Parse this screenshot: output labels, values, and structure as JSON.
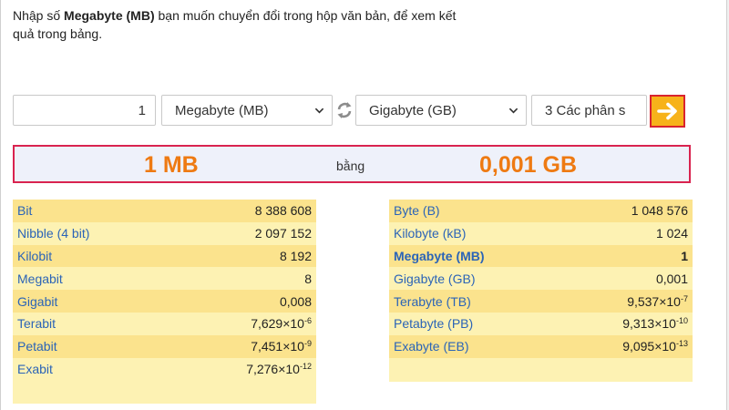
{
  "intro": {
    "prefix": "Nhập số ",
    "unit_bold": "Megabyte (MB)",
    "suffix": " bạn muốn chuyển đổi trong hộp văn bản, để xem kết quả trong bảng."
  },
  "form": {
    "input_value": "1",
    "from_unit": "Megabyte (MB)",
    "to_unit": "Gigabyte (GB)",
    "decimals": "3 Các phân s",
    "icons": {
      "swap": "swap-icon",
      "go": "arrow-right-icon",
      "caret": "chevron-down-icon"
    }
  },
  "result": {
    "from": "1 MB",
    "equals": "bằng",
    "to": "0,001 GB"
  },
  "bit_table": [
    {
      "label": "Bit",
      "value": "8 388 608"
    },
    {
      "label": "Nibble (4 bit)",
      "value": "2 097 152"
    },
    {
      "label": "Kilobit",
      "value": "8 192"
    },
    {
      "label": "Megabit",
      "value": "8"
    },
    {
      "label": "Gigabit",
      "value": "0,008"
    },
    {
      "label": "Terabit",
      "value": "7,629×10",
      "exp": "-6"
    },
    {
      "label": "Petabit",
      "value": "7,451×10",
      "exp": "-9"
    },
    {
      "label": "Exabit",
      "value": "7,276×10",
      "exp": "-12"
    }
  ],
  "byte_table": [
    {
      "label": "Byte (B)",
      "value": "1 048 576"
    },
    {
      "label": "Kilobyte (kB)",
      "value": "1 024"
    },
    {
      "label": "Megabyte (MB)",
      "value": "1",
      "bold": true
    },
    {
      "label": "Gigabyte (GB)",
      "value": "0,001"
    },
    {
      "label": "Terabyte (TB)",
      "value": "9,537×10",
      "exp": "-7"
    },
    {
      "label": "Petabyte (PB)",
      "value": "9,313×10",
      "exp": "-10"
    },
    {
      "label": "Exabyte (EB)",
      "value": "9,095×10",
      "exp": "-13"
    }
  ],
  "colors": {
    "accent_orange": "#ee7a12",
    "link_blue": "#2b64b7",
    "highlight_red": "#d9232f",
    "go_button": "#f7b21a",
    "table_light": "#fdf2b3",
    "table_dark": "#fbe38d"
  }
}
